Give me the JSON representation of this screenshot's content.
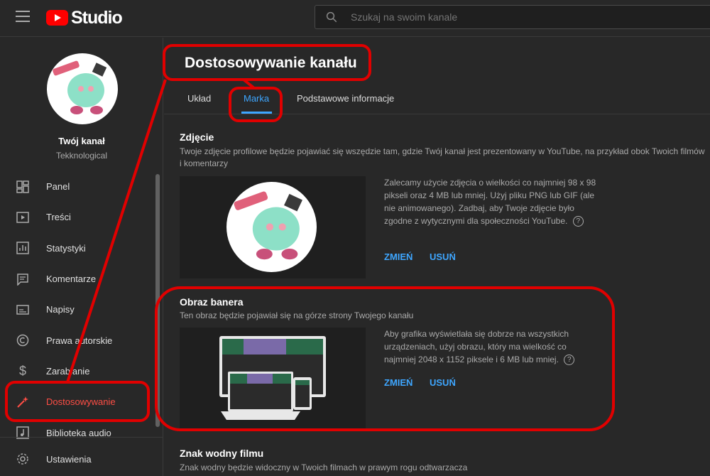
{
  "app": {
    "logo_text": "Studio"
  },
  "search": {
    "placeholder": "Szukaj na swoim kanale"
  },
  "channel": {
    "name": "Twój kanał",
    "handle": "Tekknological"
  },
  "sidebar": {
    "items": [
      {
        "label": "Panel",
        "icon": "dashboard-icon"
      },
      {
        "label": "Treści",
        "icon": "content-icon"
      },
      {
        "label": "Statystyki",
        "icon": "analytics-icon"
      },
      {
        "label": "Komentarze",
        "icon": "comments-icon"
      },
      {
        "label": "Napisy",
        "icon": "subtitles-icon"
      },
      {
        "label": "Prawa autorskie",
        "icon": "copyright-icon"
      },
      {
        "label": "Zarabianie",
        "icon": "monetization-icon"
      },
      {
        "label": "Dostosowywanie",
        "icon": "magic-wand-icon"
      },
      {
        "label": "Biblioteka audio",
        "icon": "audio-library-icon"
      }
    ],
    "settings": "Ustawienia"
  },
  "main": {
    "title": "Dostosowywanie kanału",
    "tabs": [
      "Układ",
      "Marka",
      "Podstawowe informacje"
    ],
    "active_tab": "Marka",
    "photo": {
      "title": "Zdjęcie",
      "desc": "Twoje zdjęcie profilowe będzie pojawiać się wszędzie tam, gdzie Twój kanał jest prezentowany w YouTube, na przykład obok Twoich filmów i komentarzy",
      "info": "Zalecamy użycie zdjęcia o wielkości co najmniej 98 x 98 pikseli oraz 4 MB lub mniej. Użyj pliku PNG lub GIF (ale nie animowanego). Zadbaj, aby Twoje zdjęcie było zgodne z wytycznymi dla społeczności YouTube.",
      "change": "ZMIEŃ",
      "remove": "USUŃ"
    },
    "banner": {
      "title": "Obraz banera",
      "desc": "Ten obraz będzie pojawiał się na górze strony Twojego kanału",
      "info": "Aby grafika wyświetlała się dobrze na wszystkich urządzeniach, użyj obrazu, który ma wielkość co najmniej 2048 x 1152 piksele i 6 MB lub mniej.",
      "change": "ZMIEŃ",
      "remove": "USUŃ"
    },
    "watermark": {
      "title": "Znak wodny filmu",
      "desc": "Znak wodny będzie widoczny w Twoich filmach w prawym rogu odtwarzacza"
    }
  },
  "help_glyph": "?",
  "colors": {
    "accent": "#3ea6ff",
    "active": "#ff4e45",
    "annotation": "#e10000",
    "brand": "#ff0000"
  }
}
